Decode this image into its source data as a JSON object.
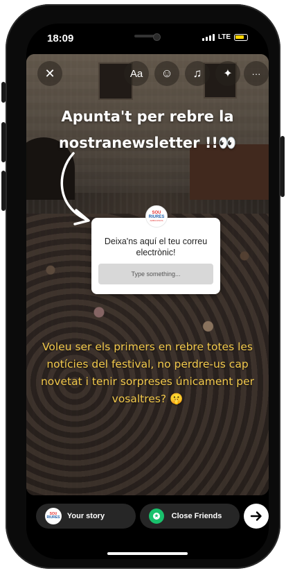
{
  "status_bar": {
    "time": "18:09",
    "network": "LTE"
  },
  "toolbar": {
    "close_glyph": "✕",
    "text_tool": "Aa",
    "sticker_glyph": "☺",
    "music_glyph": "♫",
    "effects_glyph": "✦",
    "more_glyph": "···"
  },
  "story": {
    "headline_line1": "Apunta't per rebre la",
    "headline_line2": "nostranewsletter !!👀",
    "question_sticker": {
      "logo_line1": "SOU",
      "logo_line2": "RIURES",
      "logo_line3": "AMBICIOSOS",
      "prompt": "Deixa'ns aquí el teu correu electrònic!",
      "input_placeholder": "Type something..."
    },
    "body_text": "Voleu ser els primers en rebre totes les notícies del festival, no perdre-us cap novetat i tenir sorpreses únicament per vosaltres? 🤫"
  },
  "share_bar": {
    "your_story_label": "Your story",
    "close_friends_label": "Close Friends",
    "send_glyph": "➔"
  },
  "colors": {
    "body_text": "#f2c94c",
    "close_friends_green": "#19c16c",
    "pill_bg": "#262626"
  },
  "icons": [
    "close-icon",
    "text-icon",
    "sticker-icon",
    "music-icon",
    "effects-icon",
    "more-icon",
    "arrow-icon",
    "star-icon",
    "send-icon"
  ]
}
